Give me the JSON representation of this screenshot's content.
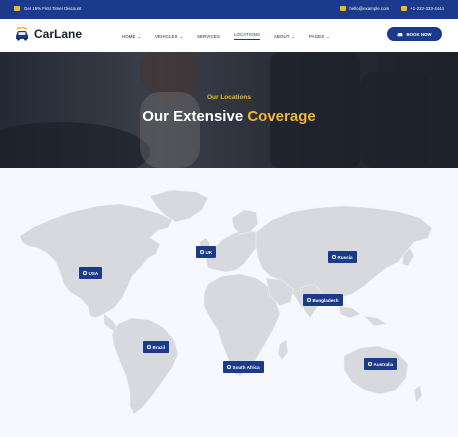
{
  "topbar": {
    "promo": "Get 15% First Timer Discount",
    "email": "hello@example.com",
    "phone": "+1-222-333-4444"
  },
  "header": {
    "brand": "CarLane",
    "nav": [
      {
        "label": "HOME",
        "dropdown": true
      },
      {
        "label": "VEHICLES",
        "dropdown": true
      },
      {
        "label": "SERVICES",
        "dropdown": false
      },
      {
        "label": "LOCATIONS",
        "dropdown": false,
        "active": true
      },
      {
        "label": "ABOUT",
        "dropdown": true
      },
      {
        "label": "PAGES",
        "dropdown": true
      }
    ],
    "cta": "BOOK NOW"
  },
  "hero": {
    "subtitle": "Our Locations",
    "title_main": "Our Extensive ",
    "title_accent": "Coverage"
  },
  "map": {
    "locations": [
      "USA",
      "UK",
      "Russia",
      "Bangladesh",
      "Brazil",
      "South Africa",
      "Australia"
    ]
  },
  "colors": {
    "primary": "#1c3a8c",
    "accent": "#f5b431",
    "map_land": "#d7d9df",
    "map_bg": "#f6f8fd"
  },
  "icons": {
    "promo": "tag-icon",
    "email": "envelope-icon",
    "phone": "phone-icon",
    "cta": "car-icon",
    "pin": "map-pin-icon"
  }
}
